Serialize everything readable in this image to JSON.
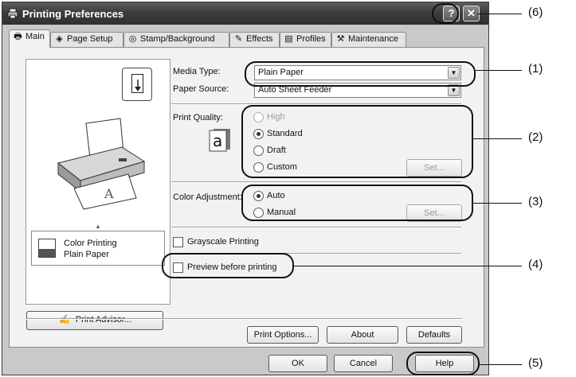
{
  "window": {
    "title": "Printing Preferences",
    "help_glyph": "?",
    "close_glyph": "✕"
  },
  "tabs": [
    {
      "label": "Main",
      "icon": "printer-icon",
      "active": true
    },
    {
      "label": "Page Setup",
      "icon": "page-setup-icon"
    },
    {
      "label": "Stamp/Background",
      "icon": "stamp-icon"
    },
    {
      "label": "Effects",
      "icon": "effects-brush-icon"
    },
    {
      "label": "Profiles",
      "icon": "profiles-icon"
    },
    {
      "label": "Maintenance",
      "icon": "maintenance-icon"
    }
  ],
  "preview": {
    "status_line1": "Color Printing",
    "status_line2": "Plain Paper",
    "print_advisor_label": "Print Advisor..."
  },
  "media": {
    "type_label": "Media Type:",
    "type_value": "Plain Paper",
    "source_label": "Paper Source:",
    "source_value": "Auto Sheet Feeder"
  },
  "quality": {
    "label": "Print Quality:",
    "options": [
      "High",
      "Standard",
      "Draft",
      "Custom"
    ],
    "selected": "Standard",
    "disabled_option": "High",
    "set_label": "Set..."
  },
  "color_adjustment": {
    "label": "Color Adjustment:",
    "options": [
      "Auto",
      "Manual"
    ],
    "selected": "Auto",
    "set_label": "Set..."
  },
  "checkboxes": {
    "grayscale_label": "Grayscale Printing",
    "preview_label": "Preview before printing",
    "grayscale_checked": false,
    "preview_checked": false
  },
  "bottom_buttons": {
    "print_options": "Print Options...",
    "about": "About",
    "defaults": "Defaults"
  },
  "dialog_buttons": {
    "ok": "OK",
    "cancel": "Cancel",
    "help": "Help"
  },
  "callouts": [
    "(1)",
    "(2)",
    "(3)",
    "(4)",
    "(5)",
    "(6)"
  ]
}
